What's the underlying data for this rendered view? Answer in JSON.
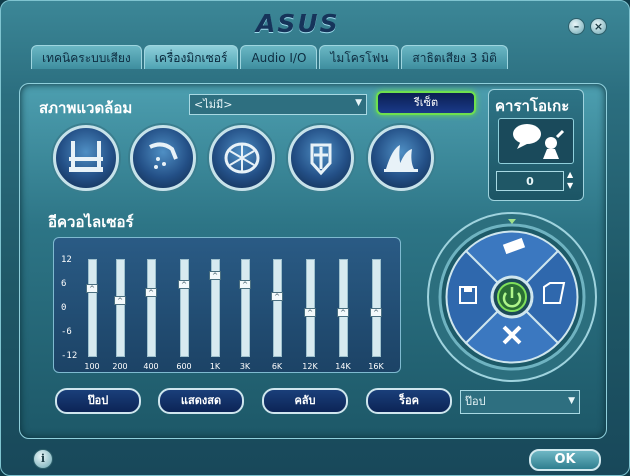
{
  "app": {
    "logo": "ASUS",
    "minimize": "–",
    "close": "×",
    "ok_label": "OK",
    "info_label": "i"
  },
  "tabs": [
    {
      "label": "เทคนิคระบบเสียง",
      "active": false
    },
    {
      "label": "เครื่องมิกเซอร์",
      "active": true
    },
    {
      "label": "Audio I/O",
      "active": false
    },
    {
      "label": "ไมโครโฟน",
      "active": false
    },
    {
      "label": "สาธิตเสียง 3 มิติ",
      "active": false
    }
  ],
  "environment": {
    "title": "สภาพแวดล้อม",
    "select_value": "<ไม่มี>",
    "reset_label": "รีเซ็ต",
    "icons": [
      "bath-icon",
      "shower-icon",
      "stadium-icon",
      "colosseum-icon",
      "opera-house-icon"
    ]
  },
  "karaoke": {
    "title": "คาราโอเกะ",
    "value": "0"
  },
  "equalizer": {
    "title": "อีควอไลเซอร์",
    "y_ticks": [
      "12",
      "6",
      "0",
      "-6",
      "-12"
    ],
    "bands": [
      {
        "freq": "100",
        "level": 5
      },
      {
        "freq": "200",
        "level": 2
      },
      {
        "freq": "400",
        "level": 4
      },
      {
        "freq": "600",
        "level": 6
      },
      {
        "freq": "1K",
        "level": 8
      },
      {
        "freq": "3K",
        "level": 6
      },
      {
        "freq": "6K",
        "level": 3
      },
      {
        "freq": "12K",
        "level": -1
      },
      {
        "freq": "14K",
        "level": -1
      },
      {
        "freq": "16K",
        "level": -1
      }
    ],
    "presets": [
      "ป๊อป",
      "แสดงสด",
      "คลับ",
      "ร็อค"
    ],
    "preset_select": "ป๊อป"
  },
  "colors": {
    "accent": "#6ee04e",
    "panel": "#2d7586",
    "button_dark": "#0c2456"
  }
}
